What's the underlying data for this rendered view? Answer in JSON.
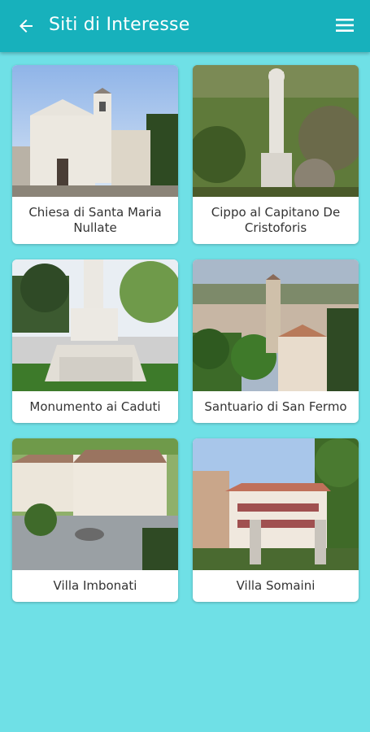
{
  "header": {
    "title": "Siti di Interesse",
    "back_icon": "arrow-left-icon",
    "menu_icon": "hamburger-menu-icon"
  },
  "colors": {
    "appbar": "#17b1bc",
    "background": "#6fe0e6"
  },
  "sites": [
    {
      "label": "Chiesa di Santa Maria Nullate"
    },
    {
      "label": "Cippo al Capitano De Cristoforis"
    },
    {
      "label": "Monumento ai Caduti"
    },
    {
      "label": "Santuario di San Fermo"
    },
    {
      "label": "Villa Imbonati"
    },
    {
      "label": "Villa Somaini"
    }
  ]
}
